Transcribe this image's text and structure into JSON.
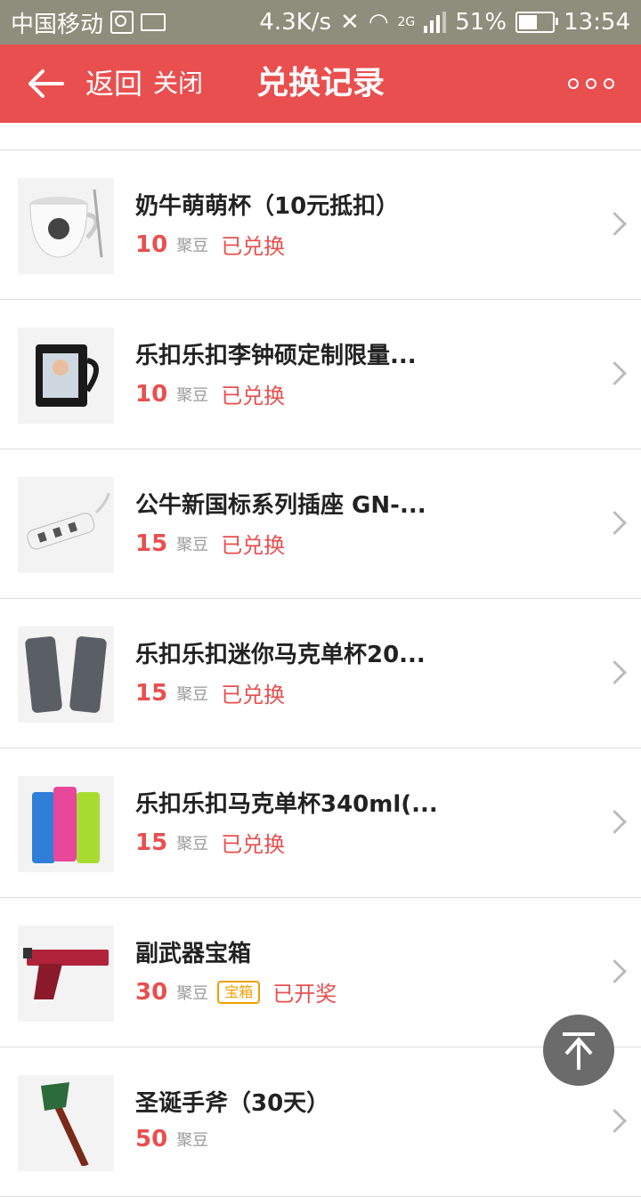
{
  "status_bar": {
    "carrier": "中国移动",
    "speed": "4.3K/s",
    "network": "2G",
    "battery": "51%",
    "time": "13:54"
  },
  "nav": {
    "back_label": "返回",
    "close_label": "关闭",
    "title": "兑换记录"
  },
  "items": [
    {
      "name": "奶牛萌萌杯（10元抵扣）",
      "price": "10",
      "unit": "聚豆",
      "tag": "",
      "status": "已兑换",
      "thumb_icon": "mug-icon"
    },
    {
      "name": "乐扣乐扣李钟硕定制限量...",
      "price": "10",
      "unit": "聚豆",
      "tag": "",
      "status": "已兑换",
      "thumb_icon": "mug-icon"
    },
    {
      "name": "公牛新国标系列插座 GN-...",
      "price": "15",
      "unit": "聚豆",
      "tag": "",
      "status": "已兑换",
      "thumb_icon": "power-strip-icon"
    },
    {
      "name": "乐扣乐扣迷你马克单杯20...",
      "price": "15",
      "unit": "聚豆",
      "tag": "",
      "status": "已兑换",
      "thumb_icon": "tumbler-icon"
    },
    {
      "name": "乐扣乐扣马克单杯340ml(...",
      "price": "15",
      "unit": "聚豆",
      "tag": "",
      "status": "已兑换",
      "thumb_icon": "tumbler-icon"
    },
    {
      "name": "副武器宝箱",
      "price": "30",
      "unit": "聚豆",
      "tag": "宝箱",
      "status": "已开奖",
      "thumb_icon": "pistol-icon"
    },
    {
      "name": "圣诞手斧（30天）",
      "price": "50",
      "unit": "聚豆",
      "tag": "",
      "status": "",
      "thumb_icon": "axe-icon"
    }
  ]
}
